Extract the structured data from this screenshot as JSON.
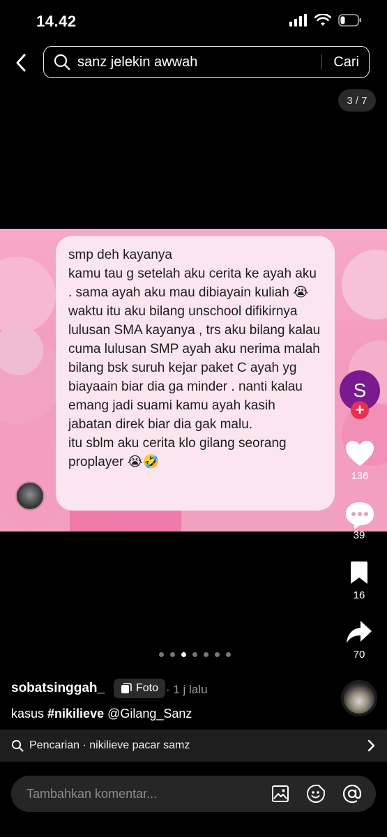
{
  "status": {
    "time": "14.42"
  },
  "search": {
    "query": "sanz jelekin awwah",
    "button": "Cari"
  },
  "post": {
    "page_indicator": "3 / 7",
    "message_lines": [
      "smp deh kayanya",
      "kamu tau g setelah aku cerita ke ayah aku . sama ayah aku mau dibiayain kuliah 😭",
      "waktu itu aku bilang unschool difikirnya lulusan SMA kayanya , trs aku bilang kalau cuma lulusan SMP ayah aku nerima malah bilang bsk suruh kejar paket C ayah yg biayaain biar dia ga minder . nanti kalau emang jadi suami kamu ayah kasih jabatan direk biar dia gak malu.",
      "itu sblm aku cerita klo gilang seorang proplayer 😭🤣"
    ],
    "creator_initial": "S",
    "likes": "136",
    "comments": "39",
    "saves": "16",
    "shares": "70",
    "total_slides": 7,
    "active_slide": 3
  },
  "caption": {
    "username": "sobatsinggah_",
    "type_chip": "Foto",
    "time": "· 1 j lalu",
    "text_plain": "kasus ",
    "hashtag": "#nikilieve",
    "mention": " @Gilang_Sanz"
  },
  "suggestion": {
    "text": "Pencarian · nikilieve pacar samz"
  },
  "comment": {
    "placeholder": "Tambahkan komentar..."
  },
  "colors": {
    "accent_red": "#e8304f",
    "creator_avatar": "#7a1a8e",
    "photo_bg": "#f49bbd"
  }
}
